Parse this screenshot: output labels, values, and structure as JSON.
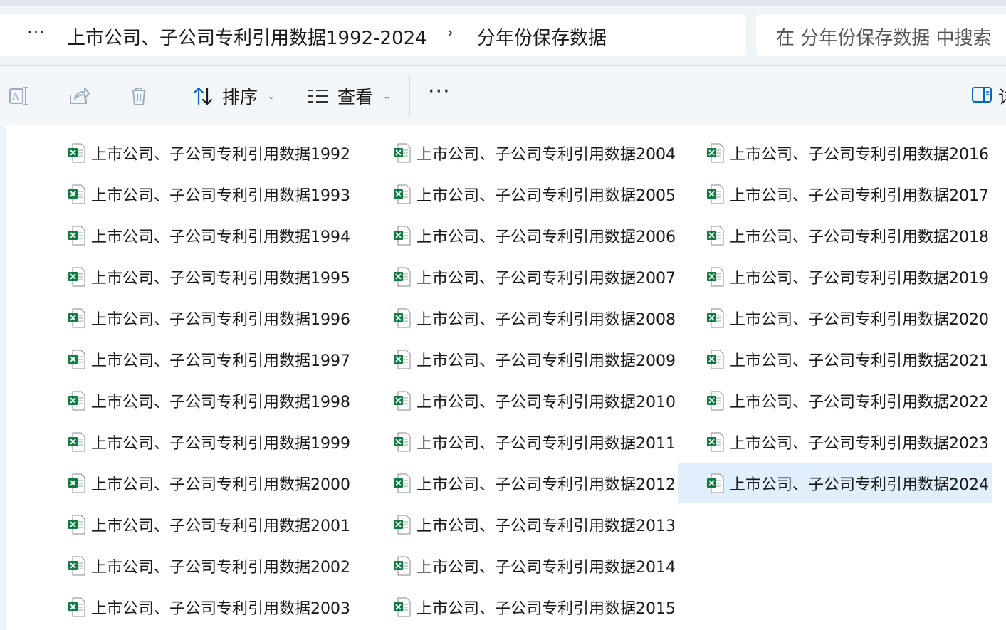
{
  "address_bar": {
    "more": "···",
    "segments": [
      "上市公司、子公司专利引用数据1992-2024",
      "分年份保存数据"
    ]
  },
  "search": {
    "placeholder": "在 分年份保存数据 中搜索"
  },
  "toolbar": {
    "sort_label": "排序",
    "view_label": "查看",
    "more": "···",
    "right_partial": "详"
  },
  "files": [
    "上市公司、子公司专利引用数据1992",
    "上市公司、子公司专利引用数据1993",
    "上市公司、子公司专利引用数据1994",
    "上市公司、子公司专利引用数据1995",
    "上市公司、子公司专利引用数据1996",
    "上市公司、子公司专利引用数据1997",
    "上市公司、子公司专利引用数据1998",
    "上市公司、子公司专利引用数据1999",
    "上市公司、子公司专利引用数据2000",
    "上市公司、子公司专利引用数据2001",
    "上市公司、子公司专利引用数据2002",
    "上市公司、子公司专利引用数据2003",
    "上市公司、子公司专利引用数据2004",
    "上市公司、子公司专利引用数据2005",
    "上市公司、子公司专利引用数据2006",
    "上市公司、子公司专利引用数据2007",
    "上市公司、子公司专利引用数据2008",
    "上市公司、子公司专利引用数据2009",
    "上市公司、子公司专利引用数据2010",
    "上市公司、子公司专利引用数据2011",
    "上市公司、子公司专利引用数据2012",
    "上市公司、子公司专利引用数据2013",
    "上市公司、子公司专利引用数据2014",
    "上市公司、子公司专利引用数据2015",
    "上市公司、子公司专利引用数据2016",
    "上市公司、子公司专利引用数据2017",
    "上市公司、子公司专利引用数据2018",
    "上市公司、子公司专利引用数据2019",
    "上市公司、子公司专利引用数据2020",
    "上市公司、子公司专利引用数据2021",
    "上市公司、子公司专利引用数据2022",
    "上市公司、子公司专利引用数据2023",
    "上市公司、子公司专利引用数据2024"
  ],
  "selected_file": "上市公司、子公司专利引用数据2024",
  "colors": {
    "accent": "#0067c0",
    "selection": "#e1eefb",
    "excel_green": "#107c41"
  },
  "icons": [
    "rename-icon",
    "share-icon",
    "delete-icon",
    "sort-icon",
    "view-icon",
    "more-icon",
    "details-pane-icon",
    "excel-file-icon"
  ]
}
